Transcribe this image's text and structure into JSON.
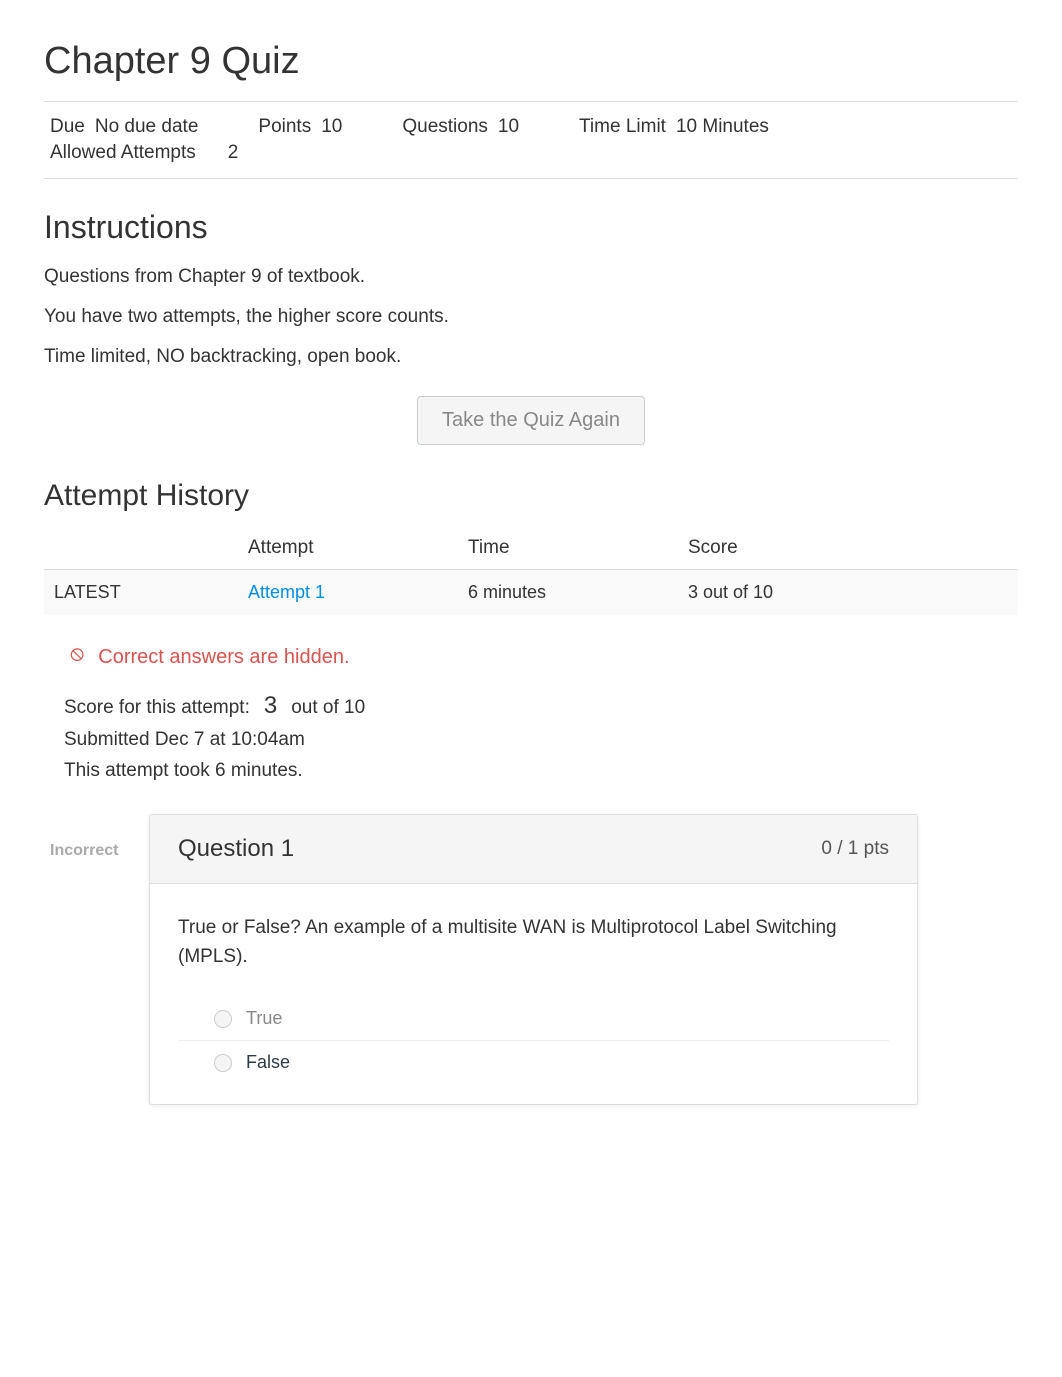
{
  "title": "Chapter 9 Quiz",
  "meta": {
    "due_label": "Due",
    "due_value": "No due date",
    "points_label": "Points",
    "points_value": "10",
    "questions_label": "Questions",
    "questions_value": "10",
    "time_limit_label": "Time Limit",
    "time_limit_value": "10 Minutes",
    "attempts_label": "Allowed Attempts",
    "attempts_value": "2"
  },
  "instructions": {
    "heading": "Instructions",
    "lines": [
      "Questions from Chapter 9 of textbook.",
      "You have two attempts, the higher score counts.",
      "Time limited, NO backtracking, open book."
    ]
  },
  "take_again_label": "Take the Quiz Again",
  "history": {
    "heading": "Attempt History",
    "columns": {
      "status": "",
      "attempt": "Attempt",
      "time": "Time",
      "score": "Score"
    },
    "rows": [
      {
        "status": "LATEST",
        "attempt": "Attempt 1",
        "time": "6 minutes",
        "score": "3 out of 10"
      }
    ]
  },
  "hidden_answers_text": "Correct answers are hidden.",
  "score_block": {
    "score_label": "Score for this attempt:",
    "score_value": "3",
    "score_suffix": "out of 10",
    "submitted": "Submitted Dec 7 at 10:04am",
    "duration": "This attempt took 6 minutes."
  },
  "question": {
    "incorrect_label": "Incorrect",
    "title": "Question 1",
    "points": "0 / 1 pts",
    "text": "True or False? An example of a multisite WAN is Multiprotocol Label Switching (MPLS).",
    "answers": [
      {
        "label": "True",
        "selected_wrong": true
      },
      {
        "label": "False",
        "selected_wrong": false
      }
    ]
  }
}
